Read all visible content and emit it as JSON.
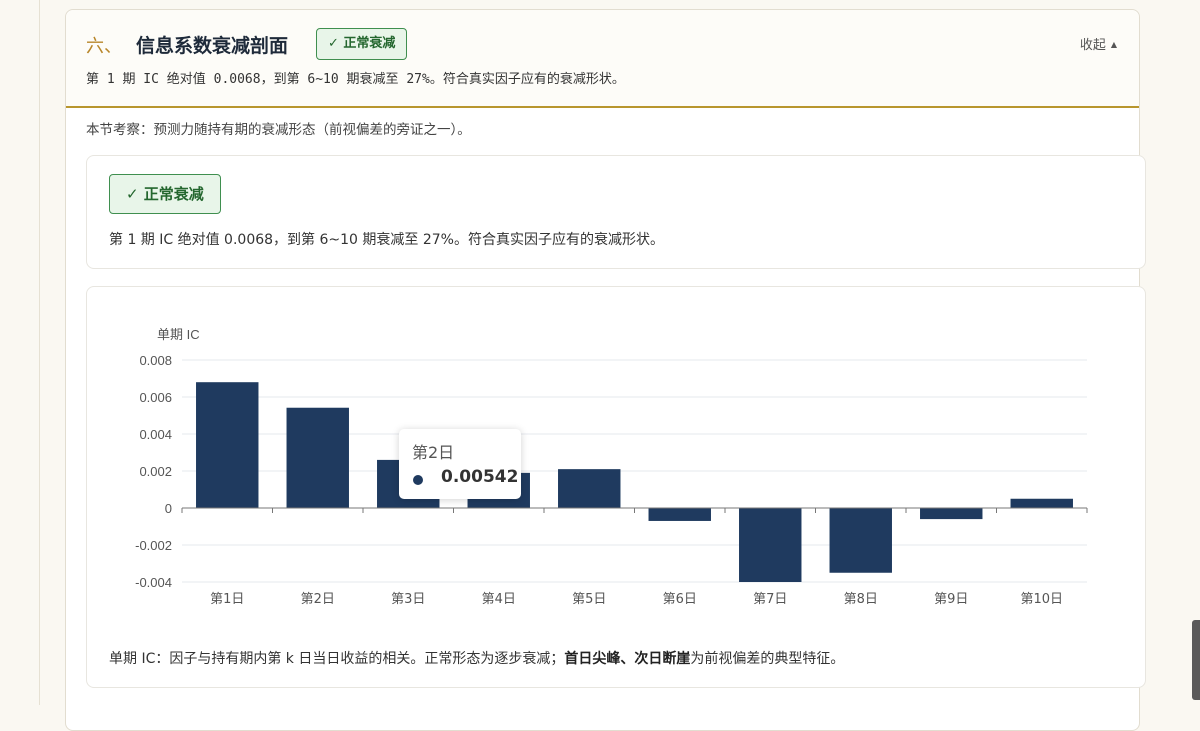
{
  "section": {
    "number": "六、",
    "title": "信息系数衰减剖面",
    "badge": "✓ 正常衰减",
    "collapse_label": "收起",
    "collapse_icon": "▲",
    "summary": "第 1 期 IC 绝对值 0.0068，到第 6~10 期衰减至 27%。符合真实因子应有的衰减形状。",
    "intro": "本节考察：预测力随持有期的衰减形态（前视偏差的旁证之一）。"
  },
  "verdict": {
    "badge": "✓ 正常衰减",
    "text": "第 1 期 IC 绝对值 0.0068，到第 6~10 期衰减至 27%。符合真实因子应有的衰减形状。"
  },
  "tooltip": {
    "title": "第2日",
    "value": "0.00542"
  },
  "footnote": {
    "prefix": "单期 IC：因子与持有期内第 k 日当日收益的相关。正常形态为逐步衰减；",
    "emphasis": "首日尖峰、次日断崖",
    "suffix": "为前视偏差的典型特征。"
  },
  "colors": {
    "bar": "#1f3a5f",
    "accent": "#b8962e",
    "badge_green": "#3f8f4f"
  },
  "chart_data": {
    "type": "bar",
    "ylabel": "单期 IC",
    "categories": [
      "第1日",
      "第2日",
      "第3日",
      "第4日",
      "第5日",
      "第6日",
      "第7日",
      "第8日",
      "第9日",
      "第10日"
    ],
    "values": [
      0.0068,
      0.00542,
      0.0026,
      0.0019,
      0.0021,
      -0.0007,
      -0.004,
      -0.0035,
      -0.0006,
      0.0005
    ],
    "ylim": [
      -0.004,
      0.008
    ],
    "yticks": [
      "0.008",
      "0.006",
      "0.004",
      "0.002",
      "0",
      "-0.002",
      "-0.004"
    ],
    "grid": true
  }
}
